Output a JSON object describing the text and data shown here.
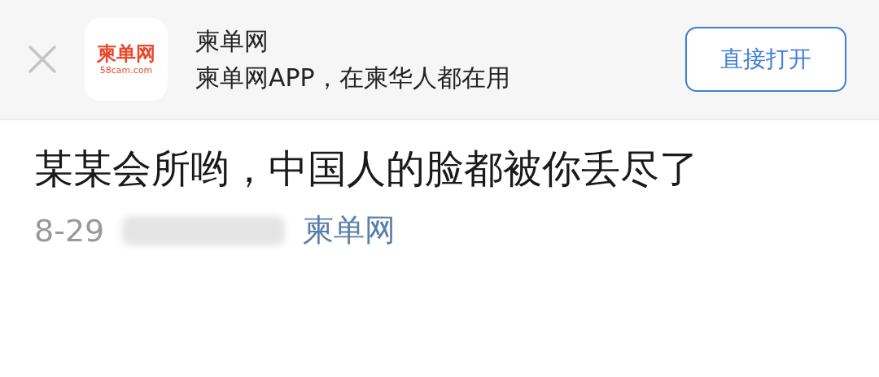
{
  "banner": {
    "logo": {
      "name": "柬单网",
      "domain": "58cam.com"
    },
    "app_name": "柬单网",
    "tagline": "柬单网APP，在柬华人都在用",
    "open_button": "直接打开"
  },
  "article": {
    "title": "某某会所哟，中国人的脸都被你丢尽了",
    "date": "8-29",
    "source": "柬单网"
  }
}
